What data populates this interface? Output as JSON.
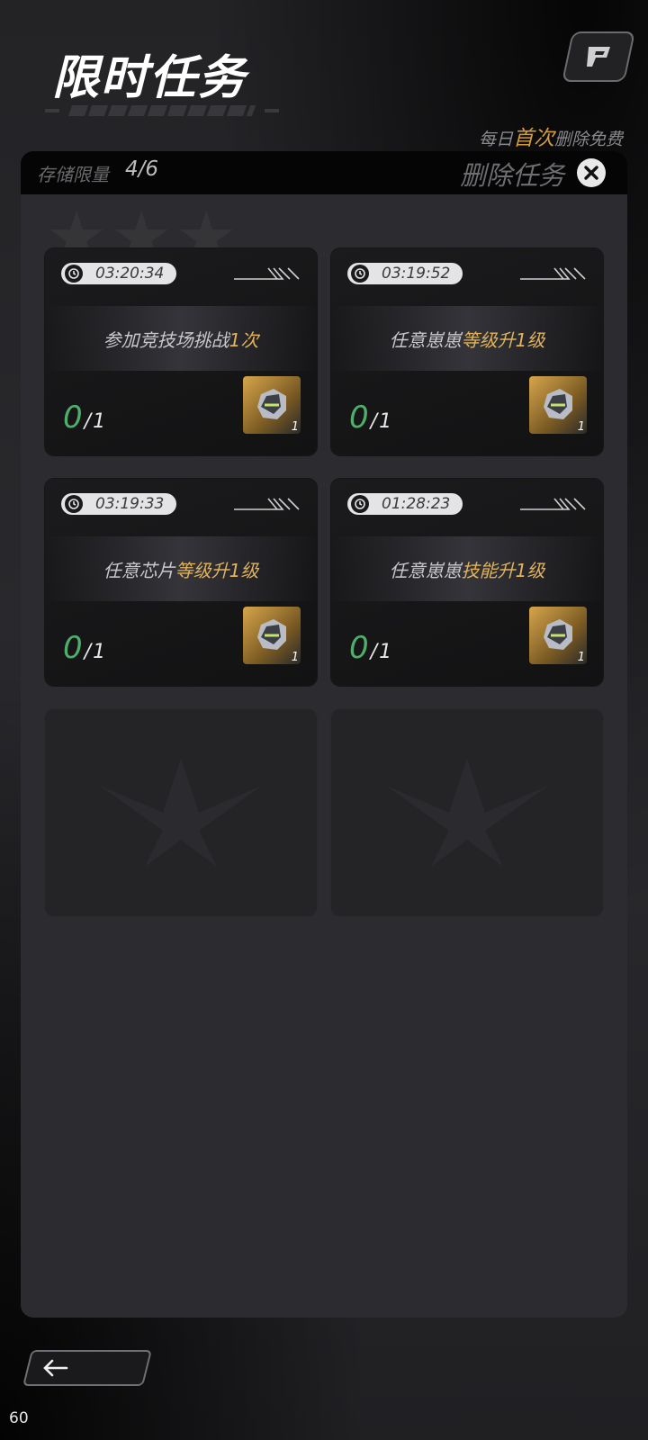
{
  "header": {
    "title": "限时任务",
    "top_button_icon": "game-logo-icon"
  },
  "daily_note": {
    "prefix": "每日",
    "highlight": "首次",
    "suffix": "删除免费"
  },
  "panel": {
    "storage_label": "存储限量",
    "storage_value": "4/6",
    "delete_label": "删除任务",
    "close_icon": "close-icon"
  },
  "tasks": [
    {
      "timer": "03:20:34",
      "text_plain": "参加竞技场挑战",
      "text_accent": "1次",
      "progress_current": "0",
      "progress_total": "1",
      "reward_count": "1"
    },
    {
      "timer": "03:19:52",
      "text_plain": "任意崽崽",
      "text_accent": "等级升1级",
      "progress_current": "0",
      "progress_total": "1",
      "reward_count": "1"
    },
    {
      "timer": "03:19:33",
      "text_plain": "任意芯片",
      "text_accent": "等级升1级",
      "progress_current": "0",
      "progress_total": "1",
      "reward_count": "1"
    },
    {
      "timer": "01:28:23",
      "text_plain": "任意崽崽",
      "text_accent": "技能升1级",
      "progress_current": "0",
      "progress_total": "1",
      "reward_count": "1"
    }
  ],
  "progress_separator": "/",
  "footer": {
    "back_icon": "back-arrow-icon",
    "fps": "60"
  },
  "colors": {
    "accent_gold": "#e2b35a",
    "progress_green": "#4fae6c",
    "panel_bg": "#2c2c30"
  }
}
